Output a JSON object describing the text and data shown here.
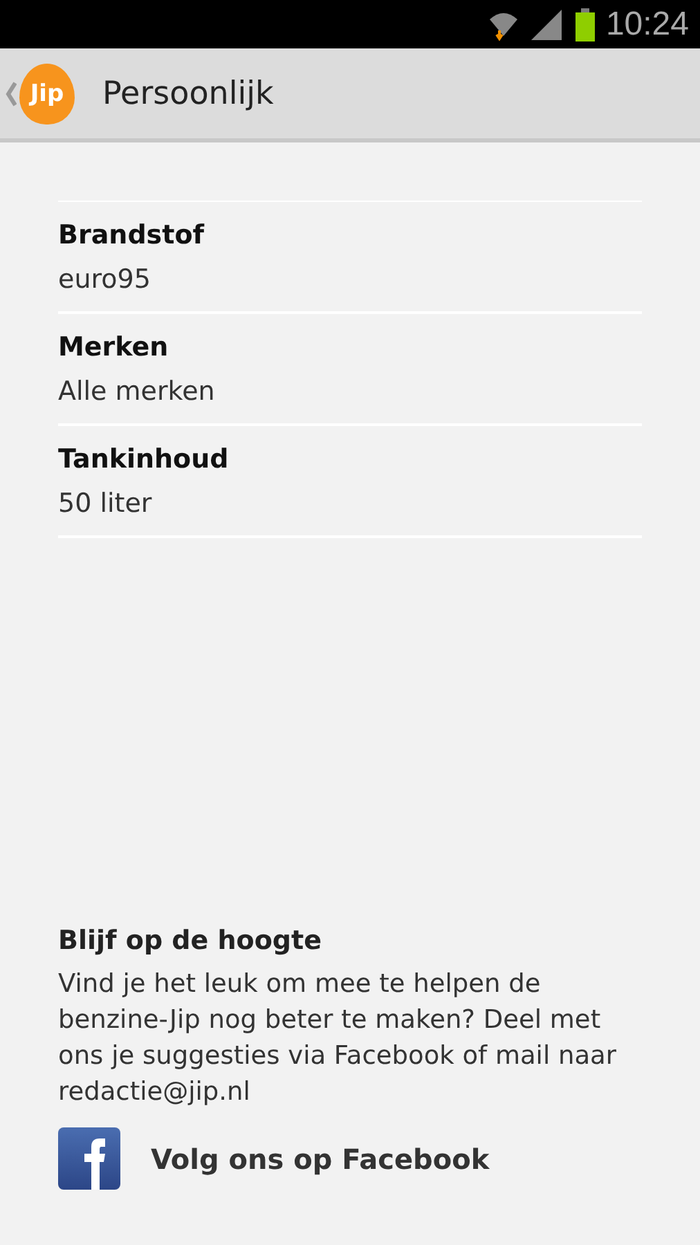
{
  "status_bar": {
    "time": "10:24"
  },
  "action_bar": {
    "logo": "Jip",
    "title": "Persoonlijk"
  },
  "settings": [
    {
      "label": "Brandstof",
      "value": "euro95"
    },
    {
      "label": "Merken",
      "value": "Alle merken"
    },
    {
      "label": "Tankinhoud",
      "value": "50 liter"
    }
  ],
  "footer": {
    "title": "Blijf op de hoogte",
    "text": "Vind je het leuk om mee te helpen de benzine-Jip nog beter te maken? Deel met ons je suggesties via Facebook of mail naar redactie@jip.nl",
    "facebook_link": "Volg ons op Facebook"
  }
}
